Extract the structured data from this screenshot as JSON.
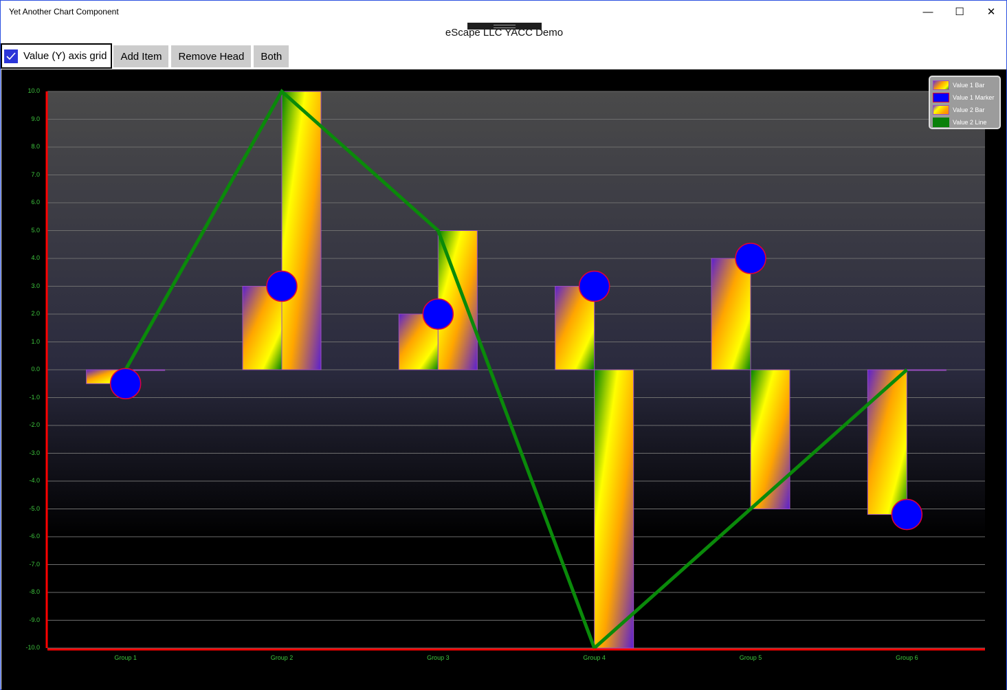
{
  "window": {
    "app_title": "Yet Another Chart Component",
    "controls": {
      "minimize": "—",
      "maximize": "☐",
      "close": "✕"
    }
  },
  "page_title": "eScape LLC YACC Demo",
  "toolbar": {
    "grid_checkbox": {
      "label": "Value (Y) axis grid",
      "checked": true
    },
    "add_item_label": "Add Item",
    "remove_head_label": "Remove Head",
    "both_label": "Both"
  },
  "colors": {
    "axis": "#ff0000",
    "tick_text": "#3fc83f",
    "marker_fill": "#0000ff",
    "marker_stroke": "#e0003a",
    "line": "#0a8a0a",
    "bar_stroke": "#9b4fc0",
    "grid": "#6e6e6e"
  },
  "legend": [
    {
      "label": "Value 1 Bar",
      "swatch": "gradient-orange-purple"
    },
    {
      "label": "Value 1 Marker",
      "swatch": "blue-red"
    },
    {
      "label": "Value 2 Bar",
      "swatch": "gradient-yellow-orange"
    },
    {
      "label": "Value 2 Line",
      "swatch": "green"
    }
  ],
  "chart_data": {
    "type": "bar",
    "title": "",
    "xlabel": "",
    "ylabel": "",
    "categories": [
      "Group 1",
      "Group 2",
      "Group 3",
      "Group 4",
      "Group 5",
      "Group 6"
    ],
    "ylim": [
      -10,
      10
    ],
    "yticks": [
      "10.0",
      "9.0",
      "8.0",
      "7.0",
      "6.0",
      "5.0",
      "4.0",
      "3.0",
      "2.0",
      "1.0",
      "0.0",
      "-1.0",
      "-2.0",
      "-3.0",
      "-4.0",
      "-5.0",
      "-6.0",
      "-7.0",
      "-8.0",
      "-9.0",
      "-10.0"
    ],
    "grid": true,
    "legend_position": "top-right",
    "series": [
      {
        "name": "Value 1 Bar",
        "kind": "bar",
        "values": [
          -0.5,
          3,
          2,
          3,
          4,
          -5.2
        ]
      },
      {
        "name": "Value 1 Marker",
        "kind": "marker",
        "values": [
          -0.5,
          3,
          2,
          3,
          4,
          -5.2
        ]
      },
      {
        "name": "Value 2 Bar",
        "kind": "bar",
        "values": [
          0,
          10,
          5,
          -10,
          -5,
          0
        ]
      },
      {
        "name": "Value 2 Line",
        "kind": "line",
        "values": [
          0,
          10,
          5,
          -10,
          -5,
          0
        ]
      }
    ]
  }
}
